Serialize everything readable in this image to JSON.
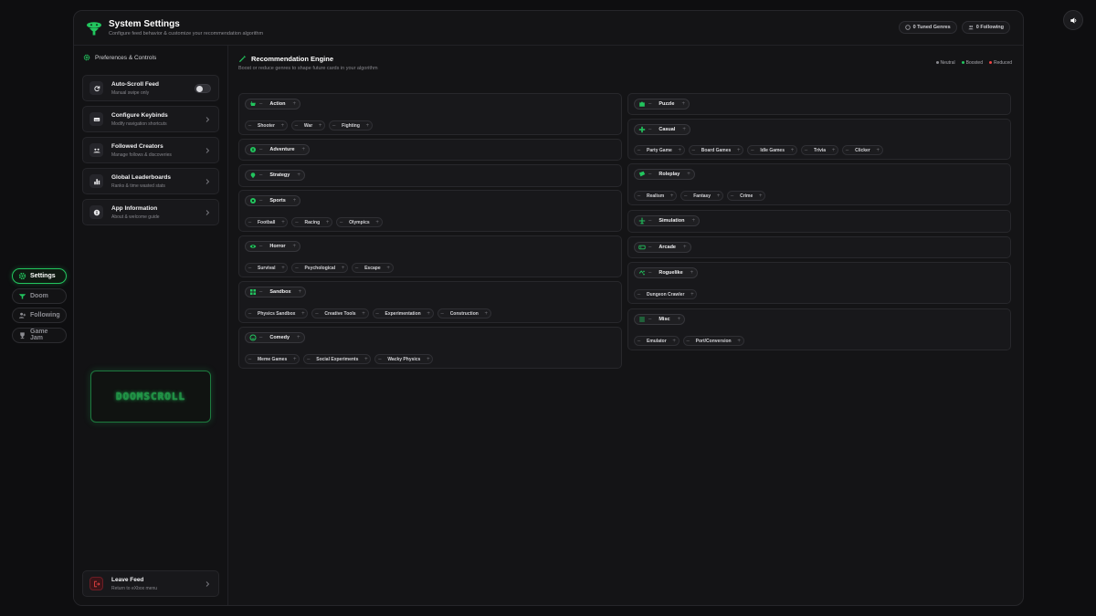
{
  "rail": {
    "items": [
      {
        "label": "Settings",
        "icon": "gear-icon",
        "active": true
      },
      {
        "label": "Doom",
        "icon": "doom-logo-icon",
        "active": false
      },
      {
        "label": "Following",
        "icon": "users-icon",
        "active": false
      },
      {
        "label": "Game Jam",
        "icon": "trophy-icon",
        "active": false
      }
    ]
  },
  "header": {
    "title": "System Settings",
    "subtitle": "Configure feed behavior & customize your recommendation algorithm",
    "tuned_genres": "0 Tuned Genres",
    "following": "0 Following"
  },
  "sidebar": {
    "heading": "Preferences & Controls",
    "items": [
      {
        "title": "Auto-Scroll Feed",
        "desc": "Manual swipe only",
        "icon": "refresh-icon"
      },
      {
        "title": "Configure Keybinds",
        "desc": "Modify navigation shortcuts",
        "icon": "keyboard-icon"
      },
      {
        "title": "Followed Creators",
        "desc": "Manage follows & discoveries",
        "icon": "users-icon"
      },
      {
        "title": "Global Leaderboards",
        "desc": "Ranks & time wasted stats",
        "icon": "bar-chart-icon"
      },
      {
        "title": "App Information",
        "desc": "About & welcome guide",
        "icon": "info-icon"
      }
    ],
    "brand": "DOOMSCROLL",
    "leave": {
      "title": "Leave Feed",
      "desc": "Return to eXbox menu"
    }
  },
  "engine": {
    "title": "Recommendation Engine",
    "subtitle": "Boost or reduce genres to shape future cards in your algorithm",
    "legend": [
      {
        "label": "Neutral",
        "color": "#8a8a90"
      },
      {
        "label": "Boosted",
        "color": "#22c55e"
      },
      {
        "label": "Reduced",
        "color": "#ef4444"
      }
    ],
    "accent": "#22c55e",
    "left_genres": [
      {
        "name": "Action",
        "icon": "gamepad-icon",
        "subs": [
          "Shooter",
          "War",
          "Fighting"
        ]
      },
      {
        "name": "Adventure",
        "icon": "compass-icon",
        "subs": []
      },
      {
        "name": "Strategy",
        "icon": "brain-icon",
        "subs": []
      },
      {
        "name": "Sports",
        "icon": "ball-icon",
        "subs": [
          "Football",
          "Racing",
          "Olympics"
        ]
      },
      {
        "name": "Horror",
        "icon": "eye-icon",
        "subs": [
          "Survival",
          "Psychological",
          "Escape"
        ]
      },
      {
        "name": "Sandbox",
        "icon": "blocks-icon",
        "subs": [
          "Physics Sandbox",
          "Creative Tools",
          "Experimentation",
          "Construction"
        ]
      },
      {
        "name": "Comedy",
        "icon": "smile-icon",
        "subs": [
          "Meme Games",
          "Social Experiments",
          "Wacky Physics"
        ]
      }
    ],
    "right_genres": [
      {
        "name": "Puzzle",
        "icon": "puzzle-icon",
        "subs": []
      },
      {
        "name": "Casual",
        "icon": "cross-icon",
        "subs": [
          "Party Game",
          "Board Games",
          "Idle Games",
          "Trivia",
          "Clicker"
        ]
      },
      {
        "name": "Roleplay",
        "icon": "ticket-icon",
        "subs": [
          "Realism",
          "Fantasy",
          "Crime"
        ]
      },
      {
        "name": "Simulation",
        "icon": "plane-icon",
        "subs": []
      },
      {
        "name": "Arcade",
        "icon": "arcade-icon",
        "subs": []
      },
      {
        "name": "Roguelike",
        "icon": "dice-icon",
        "subs": [
          "Dungeon Crawler"
        ]
      },
      {
        "name": "Misc",
        "icon": "list-icon",
        "subs": [
          "Emulator",
          "Port/Conversion"
        ]
      }
    ]
  }
}
